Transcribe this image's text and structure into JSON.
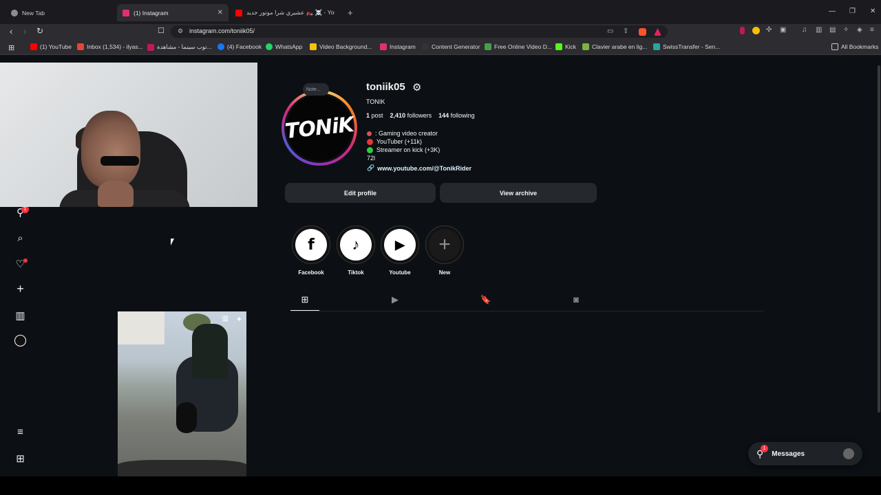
{
  "browser": {
    "tabs": [
      {
        "title": "New Tab",
        "color": "#8e8e8e"
      },
      {
        "title": "(1) Instagram",
        "color": "#e1306c"
      },
      {
        "title": "عشيري شرا موتور جديد 🏍️ ☠️ - YouTube",
        "color": "#ff0000"
      }
    ],
    "new_tab": "+",
    "url": "instagram.com/toniik05/",
    "bookmarks": [
      {
        "label": "(1) YouTube",
        "color": "#ff0000"
      },
      {
        "label": "Inbox (1,534) - ilyas...",
        "color": "#ea4335"
      },
      {
        "label": "توب سينما - مشاهدة...",
        "color": "#c2185b"
      },
      {
        "label": "(4) Facebook",
        "color": "#1877f2"
      },
      {
        "label": "WhatsApp",
        "color": "#25d366"
      },
      {
        "label": "Video Background...",
        "color": "#f4c20d"
      },
      {
        "label": "Instagram",
        "color": "#e1306c"
      },
      {
        "label": "Content Generator",
        "color": "#333333"
      },
      {
        "label": "Free Online Video D...",
        "color": "#43a047"
      },
      {
        "label": "Kick",
        "color": "#53fc18"
      },
      {
        "label": "Clavier arabe en lig...",
        "color": "#7cb342"
      },
      {
        "label": "SwissTransfer - Sen...",
        "color": "#26a69a"
      }
    ],
    "all_bookmarks": "All Bookmarks"
  },
  "profile": {
    "note": "Note...",
    "username": "toniik05",
    "full_name": "TONIK",
    "avatar_text": "TONiK",
    "stats": {
      "posts_count": "1",
      "posts_label": "post",
      "followers_count": "2,410",
      "followers_label": "followers",
      "following_count": "144",
      "following_label": "following"
    },
    "bio": [
      {
        "text": ": Gaming video creator",
        "color": "#d9534f"
      },
      {
        "text": "YouTuber (+11k)",
        "color": "#e53935"
      },
      {
        "text": "Streamer on kick (+3K)",
        "color": "#2ecc40"
      },
      {
        "text": "72l",
        "color": ""
      }
    ],
    "link": "www.youtube.com/@TonikRider",
    "edit_profile": "Edit profile",
    "view_archive": "View archive"
  },
  "highlights": [
    {
      "label": "Facebook",
      "glyph": "f"
    },
    {
      "label": "Tiktok",
      "glyph": "♪"
    },
    {
      "label": "Youtube",
      "glyph": "▶"
    },
    {
      "label": "New",
      "glyph": "+"
    }
  ],
  "messages": {
    "label": "Messages",
    "badge": "1"
  },
  "notifications_badge": "1"
}
